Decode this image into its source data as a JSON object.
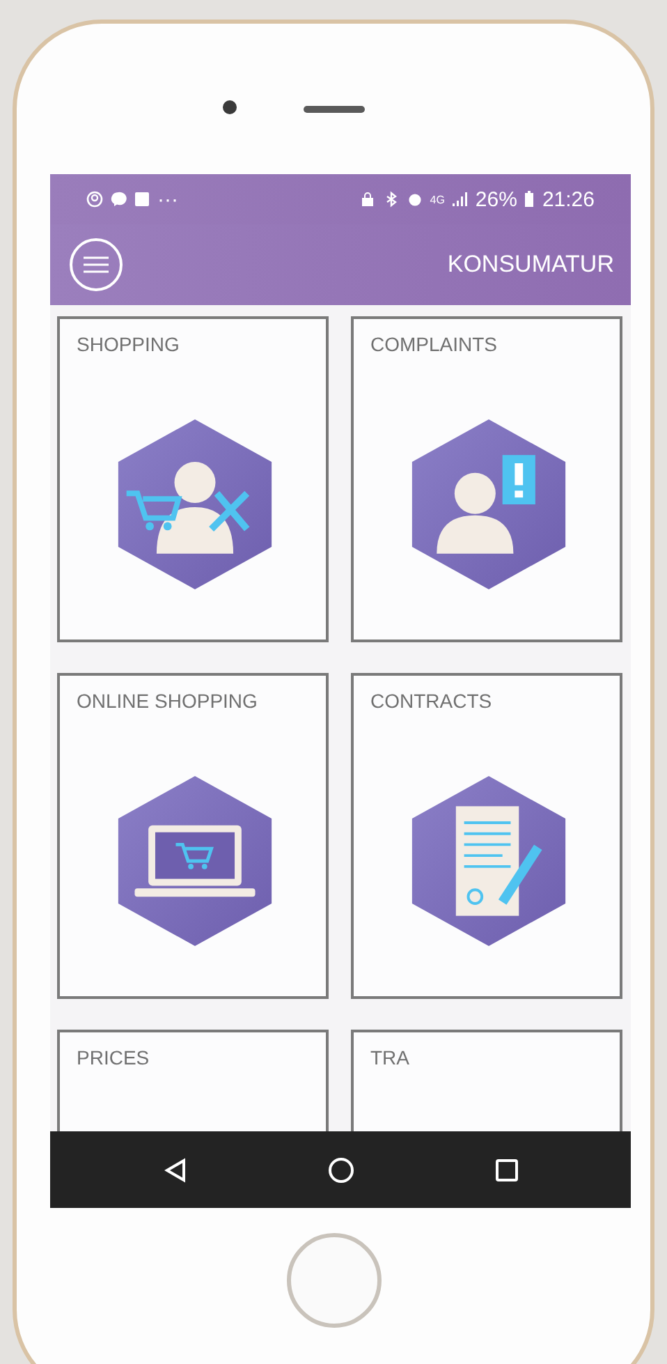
{
  "status_bar": {
    "more": "···",
    "network": "4G",
    "battery": "26%",
    "time": "21:26"
  },
  "app_bar": {
    "title": "KONSUMATUR"
  },
  "tiles": [
    {
      "label": "SHOPPING",
      "kind": "shopping"
    },
    {
      "label": "COMPLAINTS",
      "kind": "complaints"
    },
    {
      "label": "ONLINE SHOPPING",
      "kind": "online"
    },
    {
      "label": "CONTRACTS",
      "kind": "contracts"
    },
    {
      "label": "PRICES",
      "kind": "hidden"
    },
    {
      "label": "TRA",
      "kind": "hidden"
    }
  ]
}
